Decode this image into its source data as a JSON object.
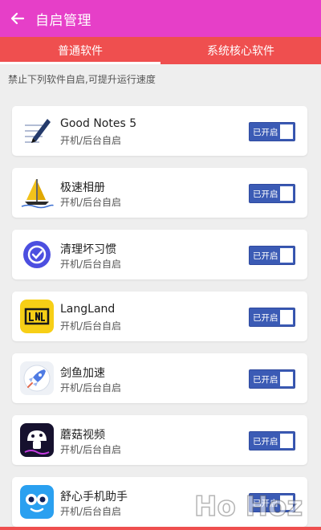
{
  "header": {
    "title": "自启管理",
    "back_icon": "back-arrow-icon",
    "bg_color": "#e63fc8"
  },
  "tabs": [
    {
      "label": "普通软件",
      "active": true
    },
    {
      "label": "系统核心软件",
      "active": false
    }
  ],
  "tab_bar_color": "#ef4f4f",
  "hint": "禁止下列软件自启,可提升运行速度",
  "apps": [
    {
      "name": "Good Notes 5",
      "status": "开机/后台自启",
      "toggle_label": "已开启",
      "icon": "goodnotes-icon"
    },
    {
      "name": "极速相册",
      "status": "开机/后台自启",
      "toggle_label": "已开启",
      "icon": "sailboat-album-icon"
    },
    {
      "name": "清理坏习惯",
      "status": "开机/后台自启",
      "toggle_label": "已开启",
      "icon": "check-circle-icon"
    },
    {
      "name": "LangLand",
      "status": "开机/后台自启",
      "toggle_label": "已开启",
      "icon": "langland-icon"
    },
    {
      "name": "剑鱼加速",
      "status": "开机/后台自启",
      "toggle_label": "已开启",
      "icon": "rocket-icon"
    },
    {
      "name": "蘑菇视频",
      "status": "开机/后台自启",
      "toggle_label": "已开启",
      "icon": "mushroom-video-icon"
    },
    {
      "name": "舒心手机助手",
      "status": "开机/后台自启",
      "toggle_label": "已开启",
      "icon": "owl-assistant-icon"
    }
  ],
  "toggle_color": "#3b5bb5",
  "watermark": "Ho Hoz"
}
